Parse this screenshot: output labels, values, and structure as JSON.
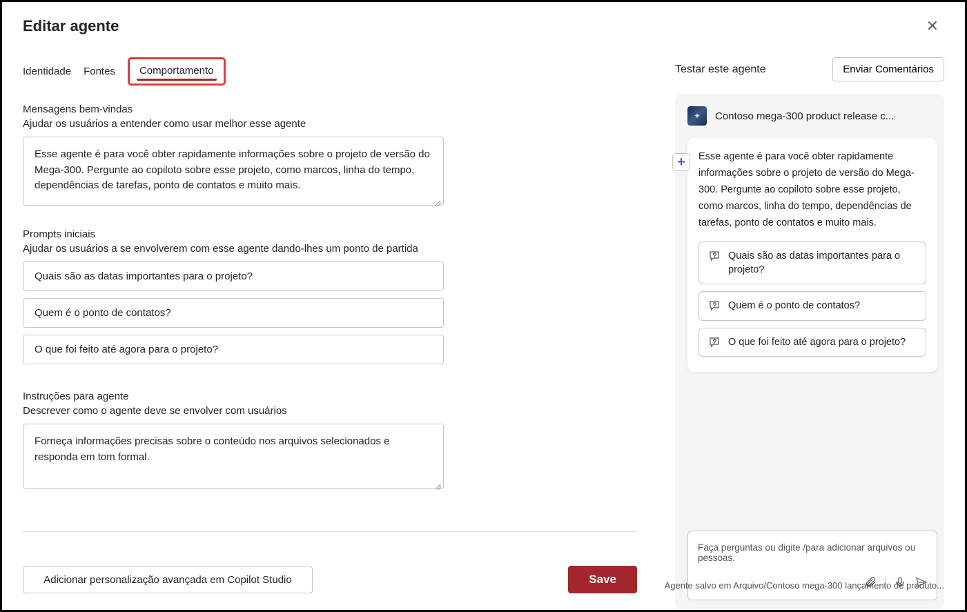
{
  "header": {
    "title": "Editar agente"
  },
  "tabs": {
    "identity": "Identidade",
    "sources": "Fontes",
    "behavior": "Comportamento"
  },
  "welcome": {
    "title": "Mensagens bem-vindas",
    "subtitle": "Ajudar os usuários a entender como usar melhor esse agente",
    "value": "Esse agente é para você obter rapidamente informações sobre o projeto de versão do Mega-300. Pergunte ao copiloto sobre esse projeto, como marcos, linha do tempo, dependências de tarefas, ponto de contatos e muito mais."
  },
  "prompts": {
    "title": "Prompts iniciais",
    "subtitle": "Ajudar os usuários a se envolverem com esse agente dando-lhes um ponto de partida",
    "items": [
      "Quais são as datas importantes para o projeto?",
      "Quem é o ponto de contatos?",
      "O que foi feito até agora para o projeto?"
    ]
  },
  "instructions": {
    "title": "Instruções para agente",
    "subtitle": "Descrever como o agente deve se envolver com usuários",
    "value": "Forneça informações precisas sobre o conteúdo nos arquivos selecionados e responda em tom formal."
  },
  "left_footer": {
    "advanced": "Adicionar personalização avançada em Copilot Studio",
    "save": "Save"
  },
  "test": {
    "title": "Testar este agente",
    "feedback": "Enviar Comentários",
    "agent_name": "Contoso mega-300 product release c...",
    "bubble_text": "Esse agente é para você obter rapidamente informações sobre o projeto de versão do Mega-300. Pergunte ao copiloto sobre esse projeto, como marcos, linha do tempo, dependências de tarefas, ponto de contatos e muito mais.",
    "suggestions": [
      "Quais são as datas importantes para o projeto?",
      "Quem é o ponto de contatos?",
      "O que foi feito até agora para o projeto?"
    ],
    "input_placeholder": "Faça perguntas ou digite /para adicionar arquivos ou pessoas."
  },
  "footer_note": "Agente salvo em Arquivo/Contoso mega-300 lançamento de produto..."
}
